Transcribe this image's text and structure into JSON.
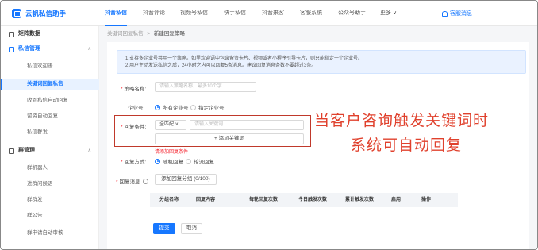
{
  "app": {
    "title": "云帆私信助手"
  },
  "nav": {
    "items": [
      "抖音私信",
      "抖音评论",
      "视频号私信",
      "快手私信",
      "抖音来客",
      "客服系统",
      "公众号助手",
      "更多 ∨"
    ],
    "active": "抖音私信",
    "notice_label": "客服消息"
  },
  "sidebar": {
    "top": "矩阵数据",
    "group1": {
      "label": "私信管理",
      "chevron": "∧"
    },
    "group1_items": [
      "私信欢迎语",
      "关键词回复私信",
      "收到私信自动回复",
      "留资自动回复",
      "私信群发"
    ],
    "active_item": "关键词回复私信",
    "group2": {
      "label": "群管理",
      "chevron": "∧"
    },
    "group2_items": [
      "群机器人",
      "进群问候语",
      "群群发",
      "群公告",
      "群申请自动审核"
    ]
  },
  "breadcrumb": {
    "parent": "关键词回复私信",
    "sep": ">",
    "current": "新建回复策略"
  },
  "tip": {
    "line1": "1.支持多企业号共用一个策略。如里欢迎语中包含留资卡片、视频或者小程序引导卡片，则只能指定一个企业号。",
    "line2": "2.用户主动发送私信之后，24小时之内可以回复5条消息。建议回复消息条数不要超过3条。"
  },
  "form": {
    "policy_name_label": "策略名称:",
    "policy_name_placeholder": "请输入策略名称，最多10个字",
    "account_label": "企业号:",
    "account_options": [
      "所有企业号",
      "指定企业号"
    ],
    "condition_label": "回复条件:",
    "match_type": "全匹配 ∨",
    "keyword_placeholder": "请输入关键词",
    "add_keyword": "+ 添加关键词",
    "error": "请添加回复条件",
    "mode_label": "回复方式:",
    "mode_options": [
      "随机回复",
      "轮流回复"
    ],
    "message_label": "回复消息",
    "add_group_btn": "添加回复分组 (0/100)",
    "table_headers": [
      "分组名称",
      "回复内容",
      "每轮回复次数",
      "今日触发次数",
      "累计触发次数",
      "启用",
      "操作"
    ],
    "submit": "提交",
    "cancel": "取消"
  },
  "annotation": {
    "line1": "当客户咨询触发关键词时",
    "line2": "系统可自动回复",
    "color": "#e0412d"
  }
}
